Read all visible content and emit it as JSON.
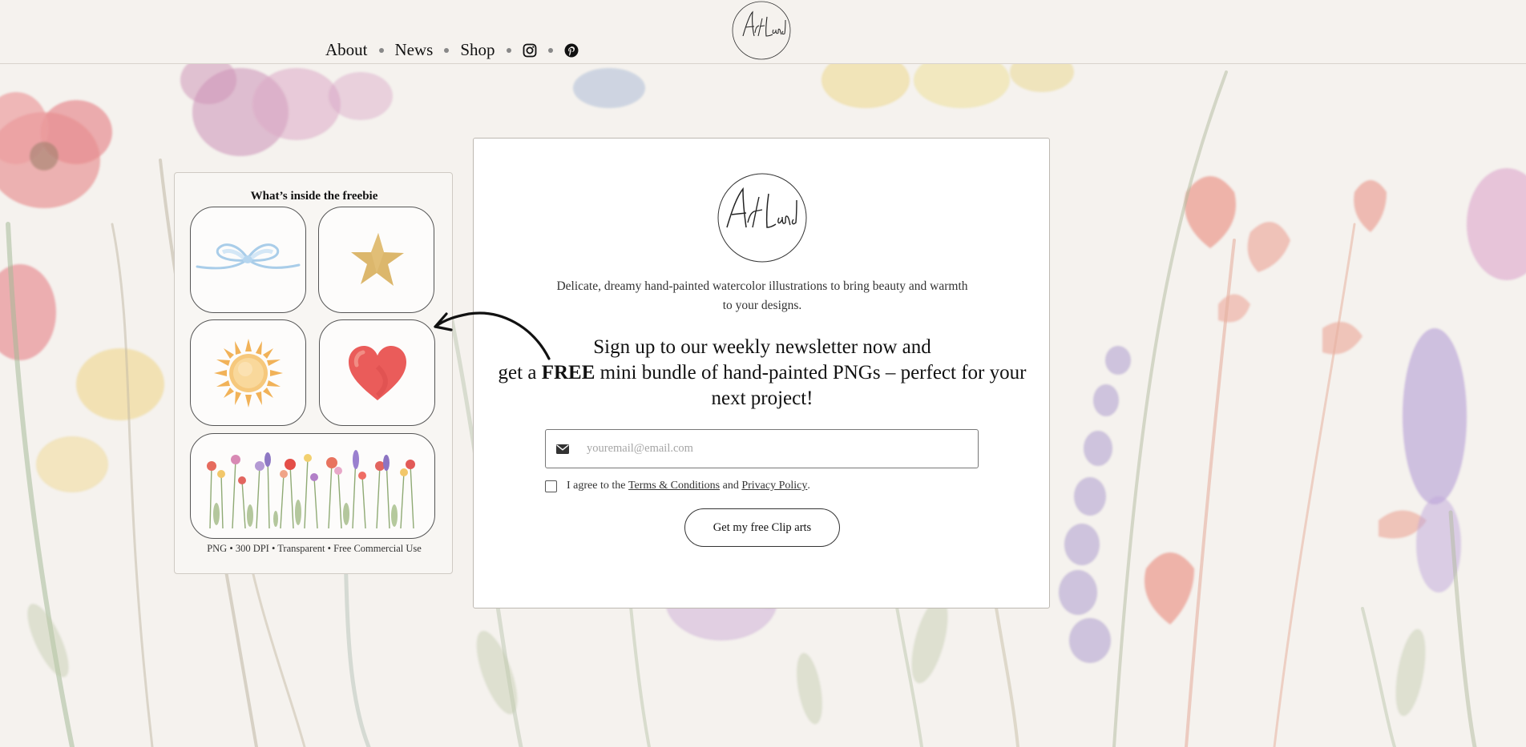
{
  "header": {
    "nav": [
      {
        "label": "About"
      },
      {
        "label": "News"
      },
      {
        "label": "Shop"
      }
    ],
    "social": [
      "instagram-icon",
      "pinterest-icon"
    ],
    "logo_text": "Art Land"
  },
  "freebie": {
    "title": "What’s inside the freebie",
    "items": [
      "blue-bow-icon",
      "gold-star-icon",
      "sun-icon",
      "red-heart-icon",
      "wildflowers-image"
    ],
    "footer": "PNG • 300 DPI • Transparent • Free Commercial Use"
  },
  "signup": {
    "logo_text": "Art Land",
    "tagline": "Delicate, dreamy hand-painted watercolor illustrations to bring beauty and warmth to your designs.",
    "headline_line1": "Sign up to our weekly newsletter now and",
    "headline_pre": "get a ",
    "headline_bold": "FREE",
    "headline_post": " mini bundle of hand-painted PNGs – perfect for your next project!",
    "email_placeholder": "youremail@email.com",
    "agree_pre": "I agree to the ",
    "terms_link": "Terms & Conditions",
    "agree_and": " and ",
    "privacy_link": "Privacy Policy",
    "agree_end": ".",
    "cta": "Get my free Clip arts"
  },
  "colors": {
    "background": "#f5f2ee",
    "card": "#ffffff",
    "text": "#222222"
  }
}
